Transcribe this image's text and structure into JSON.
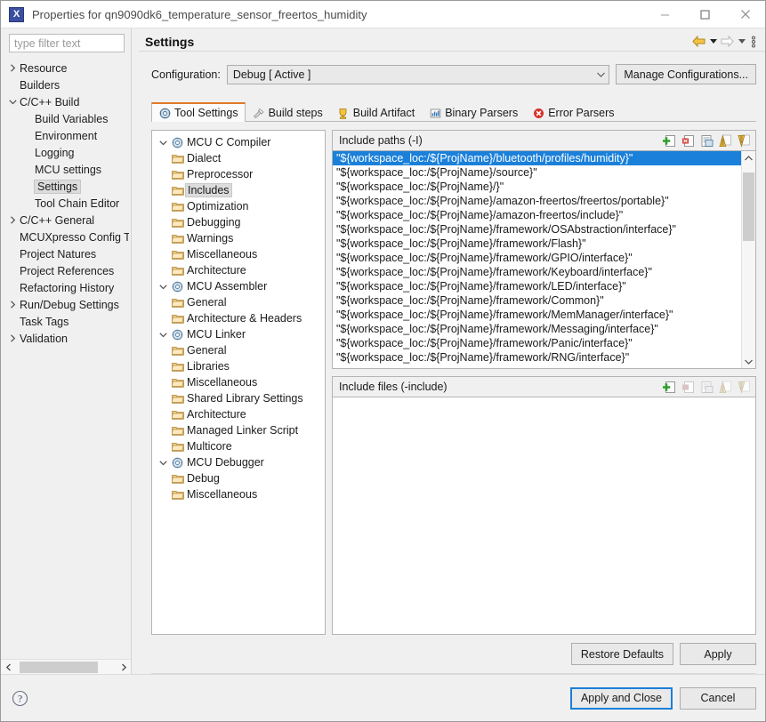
{
  "window": {
    "title": "Properties for qn9090dk6_temperature_sensor_freertos_humidity",
    "app_icon": "X",
    "minimize": "minimize-icon",
    "maximize": "maximize-icon",
    "close": "close-icon"
  },
  "filter": {
    "placeholder": "type filter text",
    "value": ""
  },
  "tree": {
    "items": [
      {
        "label": "Resource",
        "indent": 0,
        "arrow": "collapsed",
        "selected": false
      },
      {
        "label": "Builders",
        "indent": 0,
        "arrow": "none",
        "selected": false
      },
      {
        "label": "C/C++ Build",
        "indent": 0,
        "arrow": "expanded",
        "selected": false
      },
      {
        "label": "Build Variables",
        "indent": 1,
        "arrow": "none",
        "selected": false
      },
      {
        "label": "Environment",
        "indent": 1,
        "arrow": "none",
        "selected": false
      },
      {
        "label": "Logging",
        "indent": 1,
        "arrow": "none",
        "selected": false
      },
      {
        "label": "MCU settings",
        "indent": 1,
        "arrow": "none",
        "selected": false
      },
      {
        "label": "Settings",
        "indent": 1,
        "arrow": "none",
        "selected": true
      },
      {
        "label": "Tool Chain Editor",
        "indent": 1,
        "arrow": "none",
        "selected": false
      },
      {
        "label": "C/C++ General",
        "indent": 0,
        "arrow": "collapsed",
        "selected": false
      },
      {
        "label": "MCUXpresso Config T",
        "indent": 0,
        "arrow": "none",
        "selected": false
      },
      {
        "label": "Project Natures",
        "indent": 0,
        "arrow": "none",
        "selected": false
      },
      {
        "label": "Project References",
        "indent": 0,
        "arrow": "none",
        "selected": false
      },
      {
        "label": "Refactoring History",
        "indent": 0,
        "arrow": "none",
        "selected": false
      },
      {
        "label": "Run/Debug Settings",
        "indent": 0,
        "arrow": "collapsed",
        "selected": false
      },
      {
        "label": "Task Tags",
        "indent": 0,
        "arrow": "none",
        "selected": false
      },
      {
        "label": "Validation",
        "indent": 0,
        "arrow": "collapsed",
        "selected": false
      }
    ]
  },
  "page": {
    "title": "Settings",
    "nav": {
      "back": "back-arrow-icon",
      "back_menu": "chevron-down-icon",
      "forward": "forward-arrow-icon",
      "forward_menu": "chevron-down-icon",
      "view_menu": "view-menu-icon"
    }
  },
  "configuration": {
    "label": "Configuration:",
    "value": "Debug  [ Active ]",
    "manage_label": "Manage Configurations..."
  },
  "tabs": [
    {
      "label": "Tool Settings",
      "icon": "tool-settings-icon",
      "active": true
    },
    {
      "label": "Build steps",
      "icon": "build-steps-icon",
      "active": false
    },
    {
      "label": "Build Artifact",
      "icon": "build-artifact-icon",
      "active": false
    },
    {
      "label": "Binary Parsers",
      "icon": "binary-parsers-icon",
      "active": false
    },
    {
      "label": "Error Parsers",
      "icon": "error-parsers-icon",
      "active": false
    }
  ],
  "tool_tree": {
    "items": [
      {
        "label": "MCU C Compiler",
        "indent": 0,
        "arrow": "expanded",
        "icon": "tool-icon",
        "selected": false
      },
      {
        "label": "Dialect",
        "indent": 1,
        "arrow": "none",
        "icon": "folder-icon",
        "selected": false
      },
      {
        "label": "Preprocessor",
        "indent": 1,
        "arrow": "none",
        "icon": "folder-icon",
        "selected": false
      },
      {
        "label": "Includes",
        "indent": 1,
        "arrow": "none",
        "icon": "folder-icon",
        "selected": true
      },
      {
        "label": "Optimization",
        "indent": 1,
        "arrow": "none",
        "icon": "folder-icon",
        "selected": false
      },
      {
        "label": "Debugging",
        "indent": 1,
        "arrow": "none",
        "icon": "folder-icon",
        "selected": false
      },
      {
        "label": "Warnings",
        "indent": 1,
        "arrow": "none",
        "icon": "folder-icon",
        "selected": false
      },
      {
        "label": "Miscellaneous",
        "indent": 1,
        "arrow": "none",
        "icon": "folder-icon",
        "selected": false
      },
      {
        "label": "Architecture",
        "indent": 1,
        "arrow": "none",
        "icon": "folder-icon",
        "selected": false
      },
      {
        "label": "MCU Assembler",
        "indent": 0,
        "arrow": "expanded",
        "icon": "tool-icon",
        "selected": false
      },
      {
        "label": "General",
        "indent": 1,
        "arrow": "none",
        "icon": "folder-icon",
        "selected": false
      },
      {
        "label": "Architecture & Headers",
        "indent": 1,
        "arrow": "none",
        "icon": "folder-icon",
        "selected": false
      },
      {
        "label": "MCU Linker",
        "indent": 0,
        "arrow": "expanded",
        "icon": "tool-icon",
        "selected": false
      },
      {
        "label": "General",
        "indent": 1,
        "arrow": "none",
        "icon": "folder-icon",
        "selected": false
      },
      {
        "label": "Libraries",
        "indent": 1,
        "arrow": "none",
        "icon": "folder-icon",
        "selected": false
      },
      {
        "label": "Miscellaneous",
        "indent": 1,
        "arrow": "none",
        "icon": "folder-icon",
        "selected": false
      },
      {
        "label": "Shared Library Settings",
        "indent": 1,
        "arrow": "none",
        "icon": "folder-icon",
        "selected": false
      },
      {
        "label": "Architecture",
        "indent": 1,
        "arrow": "none",
        "icon": "folder-icon",
        "selected": false
      },
      {
        "label": "Managed Linker Script",
        "indent": 1,
        "arrow": "none",
        "icon": "folder-icon",
        "selected": false
      },
      {
        "label": "Multicore",
        "indent": 1,
        "arrow": "none",
        "icon": "folder-icon",
        "selected": false
      },
      {
        "label": "MCU Debugger",
        "indent": 0,
        "arrow": "expanded",
        "icon": "tool-icon",
        "selected": false
      },
      {
        "label": "Debug",
        "indent": 1,
        "arrow": "none",
        "icon": "folder-icon",
        "selected": false
      },
      {
        "label": "Miscellaneous",
        "indent": 1,
        "arrow": "none",
        "icon": "folder-icon",
        "selected": false
      }
    ]
  },
  "include_paths": {
    "header": "Include paths (-I)",
    "tools": [
      {
        "name": "add-icon",
        "enabled": true
      },
      {
        "name": "delete-icon",
        "enabled": true
      },
      {
        "name": "edit-icon",
        "enabled": true
      },
      {
        "name": "move-up-icon",
        "enabled": true
      },
      {
        "name": "move-down-icon",
        "enabled": true
      }
    ],
    "selected_index": 0,
    "scroll": {
      "up": "scroll-up-icon",
      "down": "scroll-down-icon",
      "thumb_top_pct": 4,
      "thumb_height_pct": 36
    },
    "items": [
      "\"${workspace_loc:/${ProjName}/bluetooth/profiles/humidity}\"",
      "\"${workspace_loc:/${ProjName}/source}\"",
      "\"${workspace_loc:/${ProjName}/}\"",
      "\"${workspace_loc:/${ProjName}/amazon-freertos/freertos/portable}\"",
      "\"${workspace_loc:/${ProjName}/amazon-freertos/include}\"",
      "\"${workspace_loc:/${ProjName}/framework/OSAbstraction/interface}\"",
      "\"${workspace_loc:/${ProjName}/framework/Flash}\"",
      "\"${workspace_loc:/${ProjName}/framework/GPIO/interface}\"",
      "\"${workspace_loc:/${ProjName}/framework/Keyboard/interface}\"",
      "\"${workspace_loc:/${ProjName}/framework/LED/interface}\"",
      "\"${workspace_loc:/${ProjName}/framework/Common}\"",
      "\"${workspace_loc:/${ProjName}/framework/MemManager/interface}\"",
      "\"${workspace_loc:/${ProjName}/framework/Messaging/interface}\"",
      "\"${workspace_loc:/${ProjName}/framework/Panic/interface}\"",
      "\"${workspace_loc:/${ProjName}/framework/RNG/interface}\""
    ]
  },
  "include_files": {
    "header": "Include files (-include)",
    "tools": [
      {
        "name": "add-icon",
        "enabled": true
      },
      {
        "name": "delete-icon",
        "enabled": false
      },
      {
        "name": "edit-icon",
        "enabled": false
      },
      {
        "name": "move-up-icon",
        "enabled": false
      },
      {
        "name": "move-down-icon",
        "enabled": false
      }
    ],
    "items": []
  },
  "buttons": {
    "restore_defaults": "Restore Defaults",
    "apply": "Apply",
    "apply_and_close": "Apply and Close",
    "cancel": "Cancel",
    "help": "help-icon"
  },
  "colors": {
    "selection_blue": "#1a80da",
    "tab_accent": "#e07b28",
    "window_bg": "#f0f0f0",
    "field_bg": "#ffffff"
  }
}
